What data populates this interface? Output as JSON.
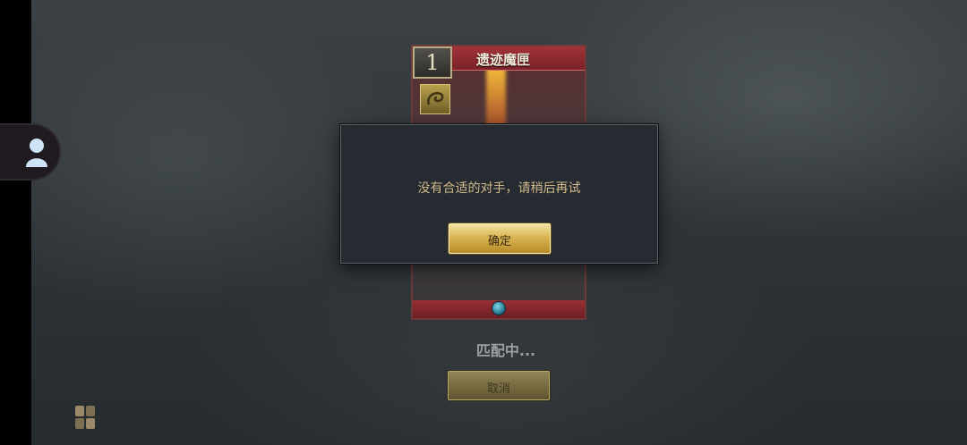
{
  "card": {
    "cost": "1",
    "name": "遗迹魔匣"
  },
  "dialog": {
    "message": "没有合适的对手，请稍后再试",
    "confirm_label": "确定"
  },
  "matching": {
    "status_text": "匹配中...",
    "cancel_label": "取消"
  },
  "icons": {
    "friends": "user-icon",
    "deck": "card-stack-icon",
    "card_type": "spell-rune-icon"
  },
  "colors": {
    "confirm_gold": "#d9b552",
    "card_red": "#a2333a",
    "dialog_text": "#d2b98a"
  }
}
